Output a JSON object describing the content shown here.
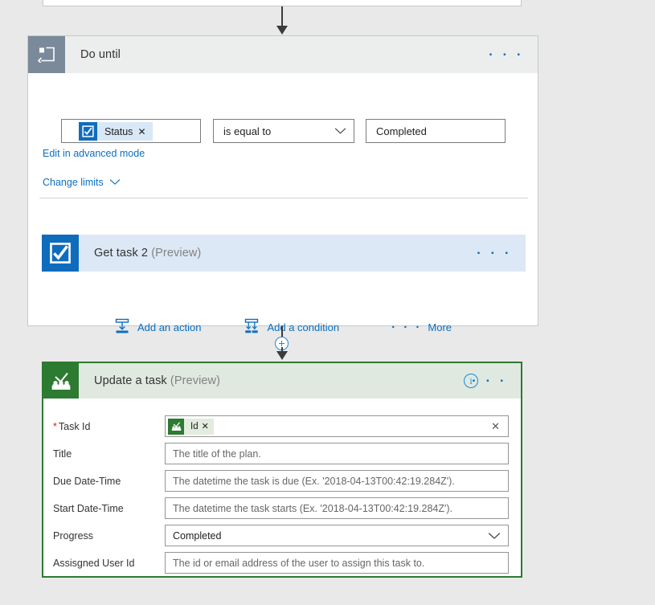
{
  "canvas": {
    "background": "#e9e9e9"
  },
  "top_card": {
    "name": "partial-card-above"
  },
  "do_until": {
    "title": "Do until",
    "icon": "loop-icon",
    "overflow_label": "· · ·",
    "condition": {
      "token": {
        "label": "Status",
        "icon": "checkbox-icon",
        "remove_label": "✕"
      },
      "operator": {
        "value": "is equal to",
        "chevron": "chevron-down-icon"
      },
      "value": "Completed"
    },
    "advanced_link": "Edit in advanced mode",
    "change_limits": "Change limits",
    "inner_action": {
      "title": "Get task 2",
      "preview": "(Preview)",
      "icon": "checkbox-icon",
      "overflow_label": "· · ·"
    },
    "add_bar": {
      "add_action": "Add an action",
      "add_condition": "Add a condition",
      "more": "More",
      "more_dots": "· · ·"
    }
  },
  "update_task": {
    "title": "Update a task",
    "preview": "(Preview)",
    "icon": "people-check-icon",
    "info_label": "i",
    "overflow_label": "· · ·",
    "accent_color": "#2d7a31",
    "fields": [
      {
        "label": "Task Id",
        "required": true,
        "kind": "token",
        "token": {
          "label": "Id",
          "icon": "people-check-icon",
          "remove_label": "✕"
        },
        "clear_label": "✕",
        "value": "",
        "placeholder": ""
      },
      {
        "label": "Title",
        "required": false,
        "kind": "text",
        "value": "",
        "placeholder": "The title of the plan."
      },
      {
        "label": "Due Date-Time",
        "required": false,
        "kind": "text",
        "value": "",
        "placeholder": "The datetime the task is due (Ex. '2018-04-13T00:42:19.284Z')."
      },
      {
        "label": "Start Date-Time",
        "required": false,
        "kind": "text",
        "value": "",
        "placeholder": "The datetime the task starts (Ex. '2018-04-13T00:42:19.284Z')."
      },
      {
        "label": "Progress",
        "required": false,
        "kind": "dropdown",
        "value": "Completed",
        "placeholder": ""
      },
      {
        "label": "Assisgned User Id",
        "required": false,
        "kind": "text",
        "value": "",
        "placeholder": "The id or email address of the user to assign this task to."
      }
    ]
  }
}
